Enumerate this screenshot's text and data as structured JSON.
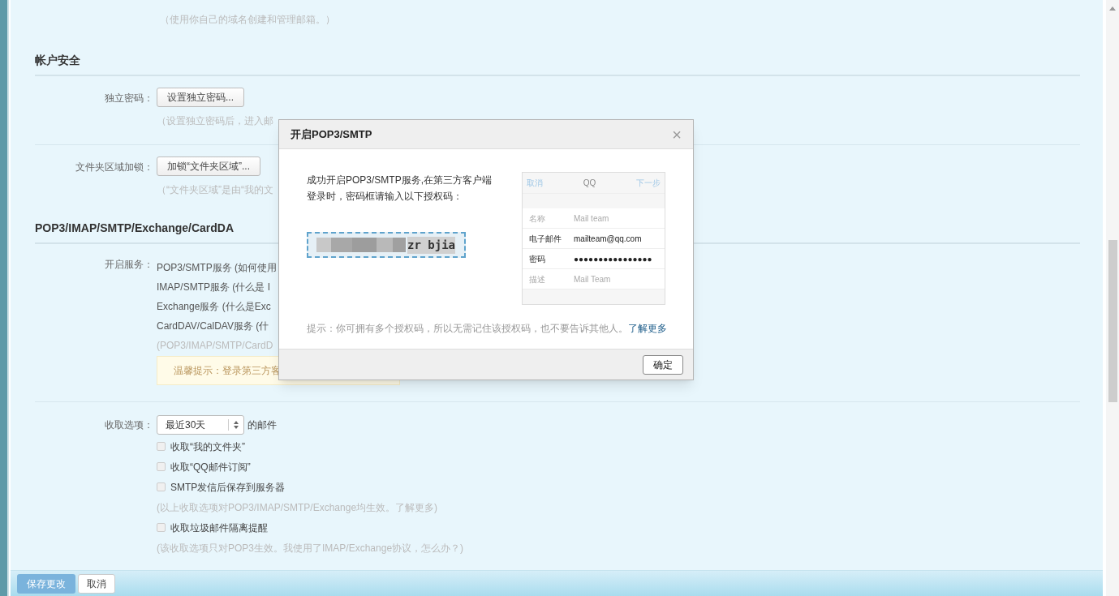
{
  "top_hint": "（使用你自己的域名创建和管理邮箱。）",
  "security": {
    "heading": "帐户安全",
    "rows": [
      {
        "label": "独立密码：",
        "button": "设置独立密码...",
        "hint": "（设置独立密码后，进入邮"
      },
      {
        "label": "文件夹区域加锁：",
        "button": "加锁“文件夹区域”...",
        "hint": "（“文件夹区域”是由“我的文"
      }
    ]
  },
  "protocols": {
    "heading": "POP3/IMAP/SMTP/Exchange/CardDA",
    "label": "开启服务：",
    "services": [
      "POP3/SMTP服务 (如何使用",
      "IMAP/SMTP服务 (什么是 I",
      "Exchange服务 (什么是Exc",
      "CardDAV/CalDAV服务 (什"
    ],
    "note": "(POP3/IMAP/SMTP/CardD",
    "tip": "温馨提示：登录第三方客"
  },
  "fetch": {
    "label": "收取选项：",
    "select": "最近30天",
    "suffix": "的邮件",
    "items": [
      {
        "kind": "checkbox",
        "text": "收取“我的文件夹”",
        "checked": false
      },
      {
        "kind": "checkbox",
        "text": "收取“QQ邮件订阅”",
        "checked": false
      },
      {
        "kind": "checkbox",
        "text": "SMTP发信后保存到服务器",
        "checked": false
      },
      {
        "kind": "hint",
        "text": "(以上收取选项对POP3/IMAP/SMTP/Exchange均生效。了解更多)"
      },
      {
        "kind": "checkbox",
        "text": "收取垃圾邮件隔离提醒",
        "checked": false
      },
      {
        "kind": "hint",
        "text": "(该收取选项只对POP3生效。我使用了IMAP/Exchange协议，怎么办？)"
      }
    ]
  },
  "footer": {
    "save": "保存更改",
    "cancel": "取消"
  },
  "dialog": {
    "title": "开启POP3/SMTP",
    "close": "×",
    "message": "成功开启POP3/SMTP服务,在第三方客户端登录时，密码框请输入以下授权码：",
    "code_visible": "zr bjia",
    "phone": {
      "left": "取消",
      "center": "QQ",
      "right": "下一步",
      "rows": [
        {
          "label": "名称",
          "value": "Mail team",
          "emphasis": false
        },
        {
          "label": "电子邮件",
          "value": "mailteam@qq.com",
          "emphasis": true
        },
        {
          "label": "密码",
          "value": "●●●●●●●●●●●●●●●●",
          "emphasis": true
        },
        {
          "label": "描述",
          "value": "Mail Team",
          "emphasis": false
        }
      ]
    },
    "tip": "提示：你可拥有多个授权码，所以无需记住该授权码，也不要告诉其他人。",
    "tip_link": "了解更多",
    "ok": "确定"
  }
}
